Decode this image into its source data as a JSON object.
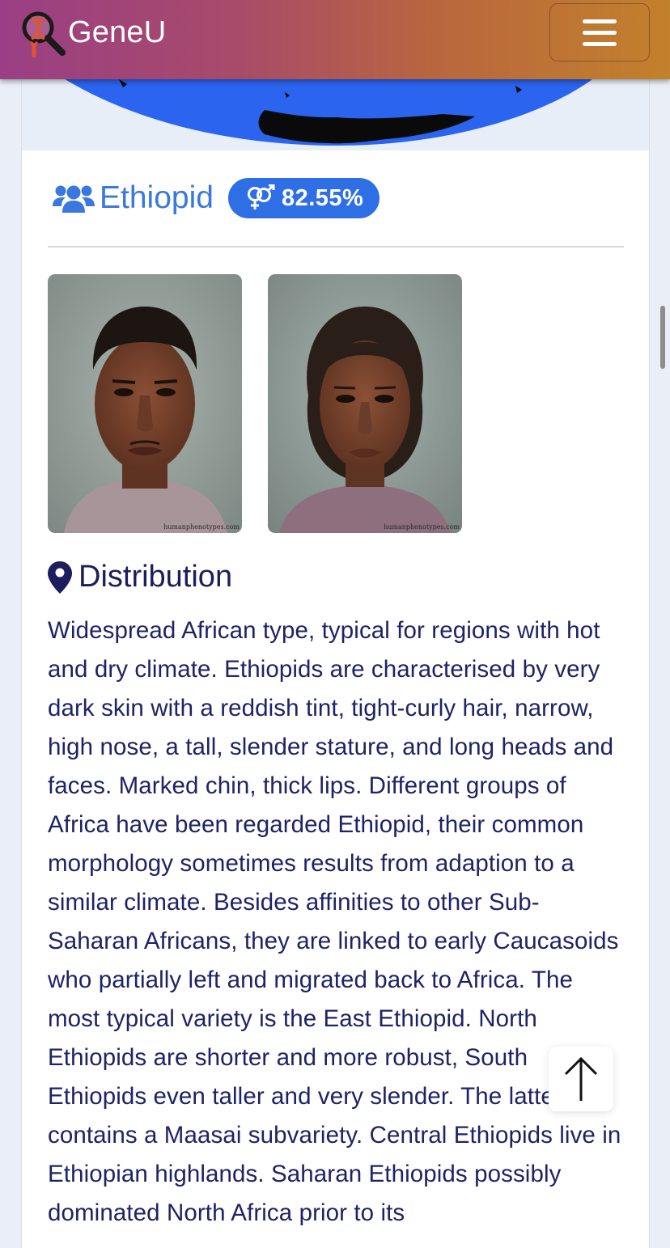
{
  "header": {
    "brand_name": "GeneU",
    "logo_icon": "magnifier-dna-icon",
    "menu_icon": "hamburger-icon",
    "colors": {
      "gradient_start": "#9a3f84",
      "gradient_end": "#c2812c"
    }
  },
  "result": {
    "group_icon": "users-icon",
    "type_name": "Ethiopid",
    "gender_icon": "gender-icon",
    "percentage": "82.55%",
    "accent_color": "#2f6fe6"
  },
  "photos": [
    {
      "label": "male-phenotype",
      "credit": "humanphenotypes.com"
    },
    {
      "label": "female-phenotype",
      "credit": "humanphenotypes.com"
    }
  ],
  "distribution": {
    "icon": "map-marker-icon",
    "title": "Distribution",
    "text": "Widespread African type, typical for regions with hot and dry climate. Ethiopids are characterised by very dark skin with a reddish tint, tight-curly hair, narrow, high nose, a tall, slender stature, and long heads and faces. Marked chin, thick lips. Different groups of Africa have been regarded Ethiopid, their common morphology sometimes results from adaption to a similar climate. Besides affinities to other Sub-Saharan Africans, they are linked to early Caucasoids who partially left and migrated back to Africa. The most typical variety is the East Ethiopid. North Ethiopids are shorter and more robust, South Ethiopids even taller and very slender. The latter contains a Maasai subvariety. Central Ethiopids live in Ethiopian highlands. Saharan Ethiopids possibly dominated North Africa prior to its"
  },
  "scroll_top_icon": "arrow-up-icon"
}
